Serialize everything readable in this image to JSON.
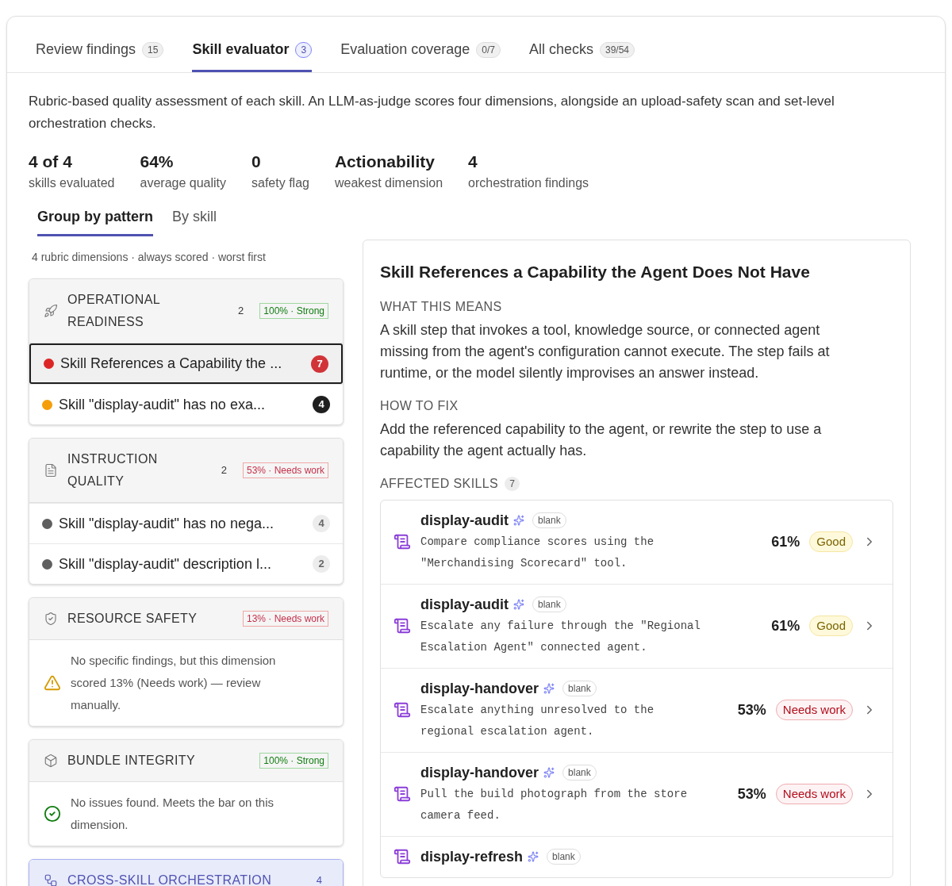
{
  "tabs": [
    {
      "label": "Review findings",
      "count": "15",
      "selected": false
    },
    {
      "label": "Skill evaluator",
      "count": "3",
      "selected": true
    },
    {
      "label": "Evaluation coverage",
      "count": "0/7",
      "selected": false
    },
    {
      "label": "All checks",
      "count": "39/54",
      "selected": false
    }
  ],
  "description": "Rubric-based quality assessment of each skill. An LLM-as-judge scores four dimensions, alongside an upload-safety scan and set-level orchestration checks.",
  "stats": [
    {
      "value": "4 of 4",
      "label": "skills evaluated"
    },
    {
      "value": "64%",
      "label": "average quality"
    },
    {
      "value": "0",
      "label": "safety flag"
    },
    {
      "value": "Actionability",
      "label": "weakest dimension"
    },
    {
      "value": "4",
      "label": "orchestration findings"
    }
  ],
  "view_tabs": [
    {
      "label": "Group by pattern",
      "selected": true
    },
    {
      "label": "By skill",
      "selected": false
    }
  ],
  "groups_caption": "4 rubric dimensions · always scored · worst first",
  "groups": [
    {
      "kind": "findings",
      "title": "OPERATIONAL READINESS",
      "count": "2",
      "score": {
        "text": "100% · Strong",
        "kind": "strong"
      },
      "highlighted": false,
      "items": [
        {
          "text": "Skill References a Capability the ...",
          "count": "7",
          "color": "#dc2626",
          "kind": "critical",
          "selected": true
        },
        {
          "text": "Skill \"display-audit\" has no exa...",
          "count": "4",
          "color": "#f59e0b",
          "kind": "major",
          "selected": false
        }
      ]
    },
    {
      "kind": "findings",
      "title": "INSTRUCTION QUALITY",
      "count": "2",
      "score": {
        "text": "53% · Needs work",
        "kind": "weak"
      },
      "highlighted": false,
      "items": [
        {
          "text": "Skill \"display-audit\" has no nega...",
          "count": "4",
          "color": "#5f5f5f",
          "kind": "minor",
          "selected": false
        },
        {
          "text": "Skill \"display-audit\" description l...",
          "count": "2",
          "color": "#5f5f5f",
          "kind": "minor",
          "selected": false
        }
      ]
    },
    {
      "kind": "message",
      "title": "RESOURCE SAFETY",
      "score": {
        "text": "13% · Needs work",
        "kind": "weak"
      },
      "highlighted": false,
      "message": {
        "kind": "warning",
        "text": "No specific findings, but this dimension scored 13% (Needs work) — review manually."
      }
    },
    {
      "kind": "message",
      "title": "BUNDLE INTEGRITY",
      "score": {
        "text": "100% · Strong",
        "kind": "strong"
      },
      "highlighted": false,
      "message": {
        "kind": "ok",
        "text": "No issues found. Meets the bar on this dimension."
      }
    },
    {
      "kind": "header",
      "title": "CROSS-SKILL ORCHESTRATION",
      "count": "4",
      "highlighted": true
    }
  ],
  "detail": {
    "title": "Skill References a Capability the Agent Does Not Have",
    "sections": [
      {
        "heading": "WHAT THIS MEANS",
        "text": "A skill step that invokes a tool, knowledge source, or connected agent missing from the agent's configuration cannot execute. The step fails at runtime, or the model silently improvises an answer instead."
      },
      {
        "heading": "HOW TO FIX",
        "text": "Add the referenced capability to the agent, or rewrite the step to use a capability the agent actually has."
      }
    ],
    "affected_heading": "AFFECTED SKILLS",
    "affected_count": "7",
    "skills": [
      {
        "name": "display-audit",
        "tag": "blank",
        "step": "Compare compliance scores using the \"Merchandising Scorecard\" tool.",
        "score": "61%",
        "rating": {
          "text": "Good",
          "kind": "good"
        }
      },
      {
        "name": "display-audit",
        "tag": "blank",
        "step": "Escalate any failure through the \"Regional Escalation Agent\" connected agent.",
        "score": "61%",
        "rating": {
          "text": "Good",
          "kind": "good"
        }
      },
      {
        "name": "display-handover",
        "tag": "blank",
        "step": "Escalate anything unresolved to the regional escalation agent.",
        "score": "53%",
        "rating": {
          "text": "Needs work",
          "kind": "weak"
        }
      },
      {
        "name": "display-handover",
        "tag": "blank",
        "step": "Pull the build photograph from the store camera feed.",
        "score": "53%",
        "rating": {
          "text": "Needs work",
          "kind": "weak"
        }
      },
      {
        "name": "display-refresh",
        "tag": "blank"
      }
    ]
  }
}
